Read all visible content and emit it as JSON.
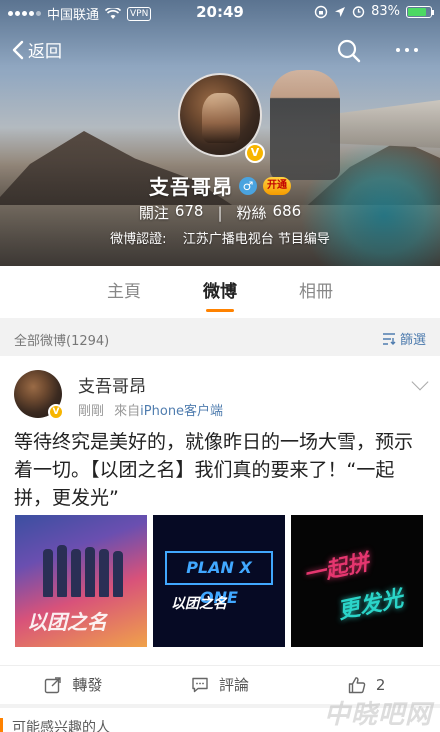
{
  "status_bar": {
    "carrier": "中国联通",
    "vpn": "VPN",
    "time": "20:49",
    "battery": "83%",
    "battery_level": 0.83
  },
  "nav": {
    "back_label": "返回"
  },
  "profile": {
    "name": "支吾哥昂",
    "vip_badge": "开通",
    "following_label": "關注",
    "following_count": "678",
    "followers_label": "粉絲",
    "followers_count": "686",
    "verified_label": "微博認證:",
    "verified_text": "江苏广播电视台 节目编导"
  },
  "tabs": [
    {
      "label": "主頁"
    },
    {
      "label": "微博"
    },
    {
      "label": "相冊"
    }
  ],
  "filter": {
    "count_label": "全部微博(1294)",
    "filter_label": "篩選"
  },
  "post": {
    "author": "支吾哥昂",
    "time": "剛剛",
    "source_prefix": "來自",
    "source": "iPhone客户端",
    "text": "等待终究是美好的，就像昨日的一场大雪，预示着一切。【以团之名】我们真的要来了！“一起拼，更发光”",
    "images": [
      {
        "caption": "以团之名"
      },
      {
        "caption_top": "PLAN X ONE",
        "caption_bottom": "以团之名"
      },
      {
        "caption_top": "一起拼",
        "caption_bottom": "更发光"
      }
    ],
    "actions": {
      "repost": "轉發",
      "comment": "評論",
      "like_count": "2"
    }
  },
  "next_section": {
    "title": "可能感兴趣的人"
  },
  "watermark": "中晓吧网"
}
